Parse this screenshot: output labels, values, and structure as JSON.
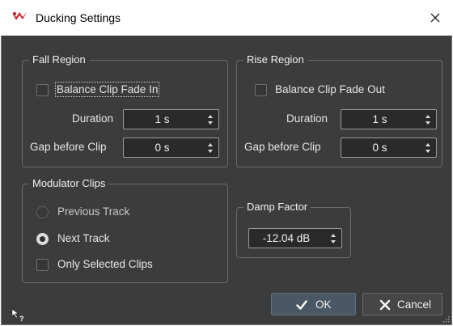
{
  "window": {
    "title": "Ducking Settings",
    "close_glyph": "×"
  },
  "fall_region": {
    "title": "Fall Region",
    "balance_label": "Balance Clip Fade In",
    "balance_checked": false,
    "duration_label": "Duration",
    "duration_value": "1 s",
    "gap_label": "Gap before Clip",
    "gap_value": "0 s"
  },
  "rise_region": {
    "title": "Rise Region",
    "balance_label": "Balance Clip Fade Out",
    "balance_checked": false,
    "duration_label": "Duration",
    "duration_value": "1 s",
    "gap_label": "Gap before Clip",
    "gap_value": "0 s"
  },
  "modulator": {
    "title": "Modulator Clips",
    "options": [
      "Previous Track",
      "Next Track"
    ],
    "selected": "Next Track",
    "only_selected_label": "Only Selected Clips",
    "only_selected_checked": false
  },
  "damp": {
    "title": "Damp Factor",
    "value": "-12.04 dB"
  },
  "buttons": {
    "ok": "OK",
    "cancel": "Cancel"
  },
  "icons": {
    "app": "app-logo-icon",
    "close": "close-icon",
    "help": "whats-this-help-icon",
    "ok": "checkmark-icon",
    "cancel": "x-icon",
    "grip": "resize-grip-icon"
  },
  "colors": {
    "background": "#3c3c3c",
    "title_bar": "#ffffff",
    "logo_red": "#d3222a",
    "ok_button": "#4a5866"
  }
}
